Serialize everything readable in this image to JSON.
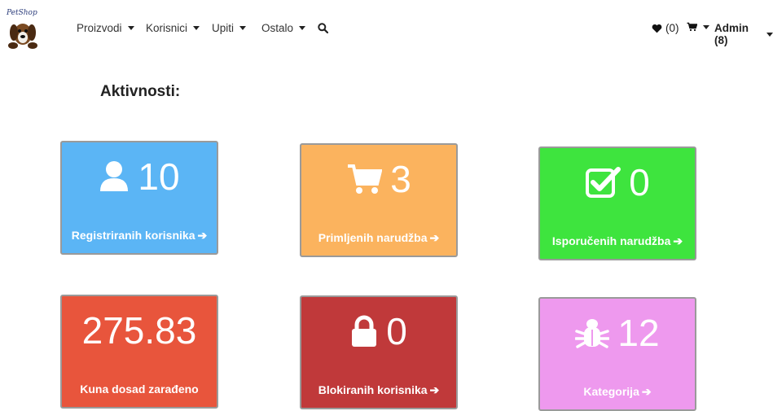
{
  "app": {
    "logo_text": "PetShop"
  },
  "nav": {
    "items": [
      {
        "label": "Proizvodi"
      },
      {
        "label": "Korisnici"
      },
      {
        "label": "Upiti"
      },
      {
        "label": "Ostalo"
      }
    ],
    "wishlist_count": "(0)",
    "user_label": "Admin (8)"
  },
  "page": {
    "title": "Aktivnosti:"
  },
  "cards": [
    {
      "value": "10",
      "label": "Registriranih korisnika",
      "icon": "user-icon",
      "color": "#5bb5f5"
    },
    {
      "value": "3",
      "label": "Primljenih narudžba",
      "icon": "cart-icon",
      "color": "#fbb35e"
    },
    {
      "value": "0",
      "label": "Isporučenih narudžba",
      "icon": "checkbox-icon",
      "color": "#3ee43e"
    },
    {
      "value": "275.83",
      "label": "Kuna dosad zarađeno",
      "icon": "",
      "color": "#e8553c"
    },
    {
      "value": "0",
      "label": "Blokiranih korisnika",
      "icon": "lock-icon",
      "color": "#c0393a"
    },
    {
      "value": "12",
      "label": "Kategorija",
      "icon": "bug-icon",
      "color": "#ee99ee"
    }
  ]
}
